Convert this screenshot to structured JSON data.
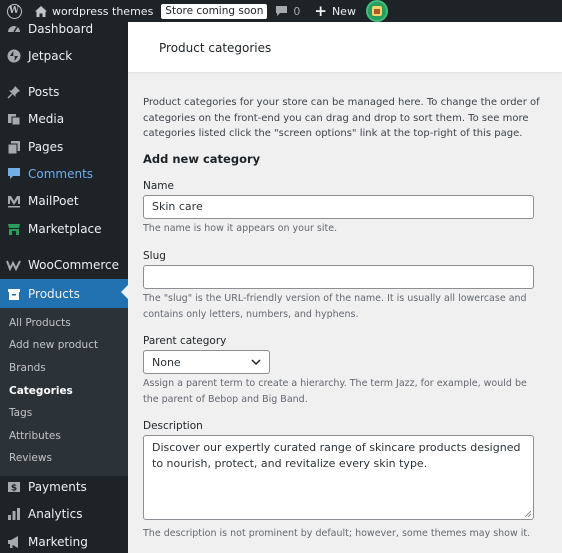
{
  "adminbar": {
    "wp_logo_icon": "wordpress-logo-icon",
    "home_icon": "home-icon",
    "site_name": "wordpress themes",
    "store_badge": "Store coming soon",
    "comment_icon": "comment-bubble-icon",
    "comment_count": "0",
    "new_icon": "plus-icon",
    "new_label": "New",
    "avatar": "user-avatar"
  },
  "sidebar": {
    "items": [
      {
        "label": "Dashboard",
        "icon": "dashboard-icon"
      },
      {
        "label": "Jetpack",
        "icon": "jetpack-icon"
      },
      {
        "label": "Posts",
        "icon": "pin-icon"
      },
      {
        "label": "Media",
        "icon": "media-icon"
      },
      {
        "label": "Pages",
        "icon": "pages-icon"
      },
      {
        "label": "Comments",
        "icon": "comments-icon"
      },
      {
        "label": "MailPoet",
        "icon": "mailpoet-icon"
      },
      {
        "label": "Marketplace",
        "icon": "marketplace-icon"
      },
      {
        "label": "WooCommerce",
        "icon": "woocommerce-icon"
      },
      {
        "label": "Products",
        "icon": "products-icon"
      },
      {
        "label": "Payments",
        "icon": "payments-icon"
      },
      {
        "label": "Analytics",
        "icon": "analytics-icon"
      },
      {
        "label": "Marketing",
        "icon": "marketing-icon"
      }
    ],
    "submenu": [
      "All Products",
      "Add new product",
      "Brands",
      "Categories",
      "Tags",
      "Attributes",
      "Reviews"
    ],
    "current_submenu": "Categories"
  },
  "header": {
    "title": "Product categories"
  },
  "main": {
    "intro": "Product categories for your store can be managed here. To change the order of categories on the front-end you can drag and drop to sort them. To see more categories listed click the \"screen options\" link at the top-right of this page.",
    "section_title": "Add new category",
    "name_label": "Name",
    "name_value": "Skin care",
    "name_help": "The name is how it appears on your site.",
    "slug_label": "Slug",
    "slug_value": "",
    "slug_help": "The \"slug\" is the URL-friendly version of the name. It is usually all lowercase and contains only letters, numbers, and hyphens.",
    "parent_label": "Parent category",
    "parent_value": "None",
    "parent_help": "Assign a parent term to create a hierarchy. The term Jazz, for example, would be the parent of Bebop and Big Band.",
    "description_label": "Description",
    "description_value": "Discover our expertly curated range of skincare products designed to nourish, protect, and revitalize every skin type.",
    "description_help": "The description is not prominent by default; however, some themes may show it."
  },
  "colors": {
    "admin_bg": "#1d2327",
    "accent": "#2271b1",
    "submenu_bg": "#2c3338",
    "content_bg": "#f0f0f1"
  }
}
